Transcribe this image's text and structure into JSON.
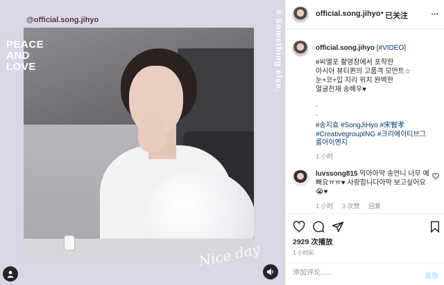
{
  "media": {
    "watermark": "@official.song.jihyo",
    "overlay_lines": [
      "PEACE",
      "AND",
      "LOVE"
    ],
    "vertical_text": "# Something else.",
    "script_text": "Nice day"
  },
  "header": {
    "username": "official.song.jihyo",
    "separator": "•",
    "follow_label": "已关注",
    "more": "..."
  },
  "caption": {
    "username": "official.song.jihyo",
    "video_tag": "[#VIDEO]",
    "lines": [
      "#씨엘포 촬영장에서 포착한",
      "아시아 뷰티퀸의 고품격 모먼트☆",
      "눈+코+입 지리 위치 완벽한",
      "얼굴천재 송배우♥",
      ".",
      "."
    ],
    "tags_line1": "#송지효 #SongJiHyo #宋智孝",
    "tags_line2": "#CreativegroupING #크리에이티브그",
    "tags_line3": "룹아이엔지",
    "time": "1 小时"
  },
  "comment": {
    "username": "luvssong815",
    "text": "악아아악 송언니 너무 예뻐요ㅠㅠ♥ 사랑합니다아악 보고싶어요😭♥",
    "time": "1 小时",
    "likes": "3 次赞",
    "reply": "回复"
  },
  "stats": {
    "likes": "2929 次播放",
    "time": "1 小时前"
  },
  "compose": {
    "placeholder": "添加评论......",
    "post_label": "发布"
  }
}
